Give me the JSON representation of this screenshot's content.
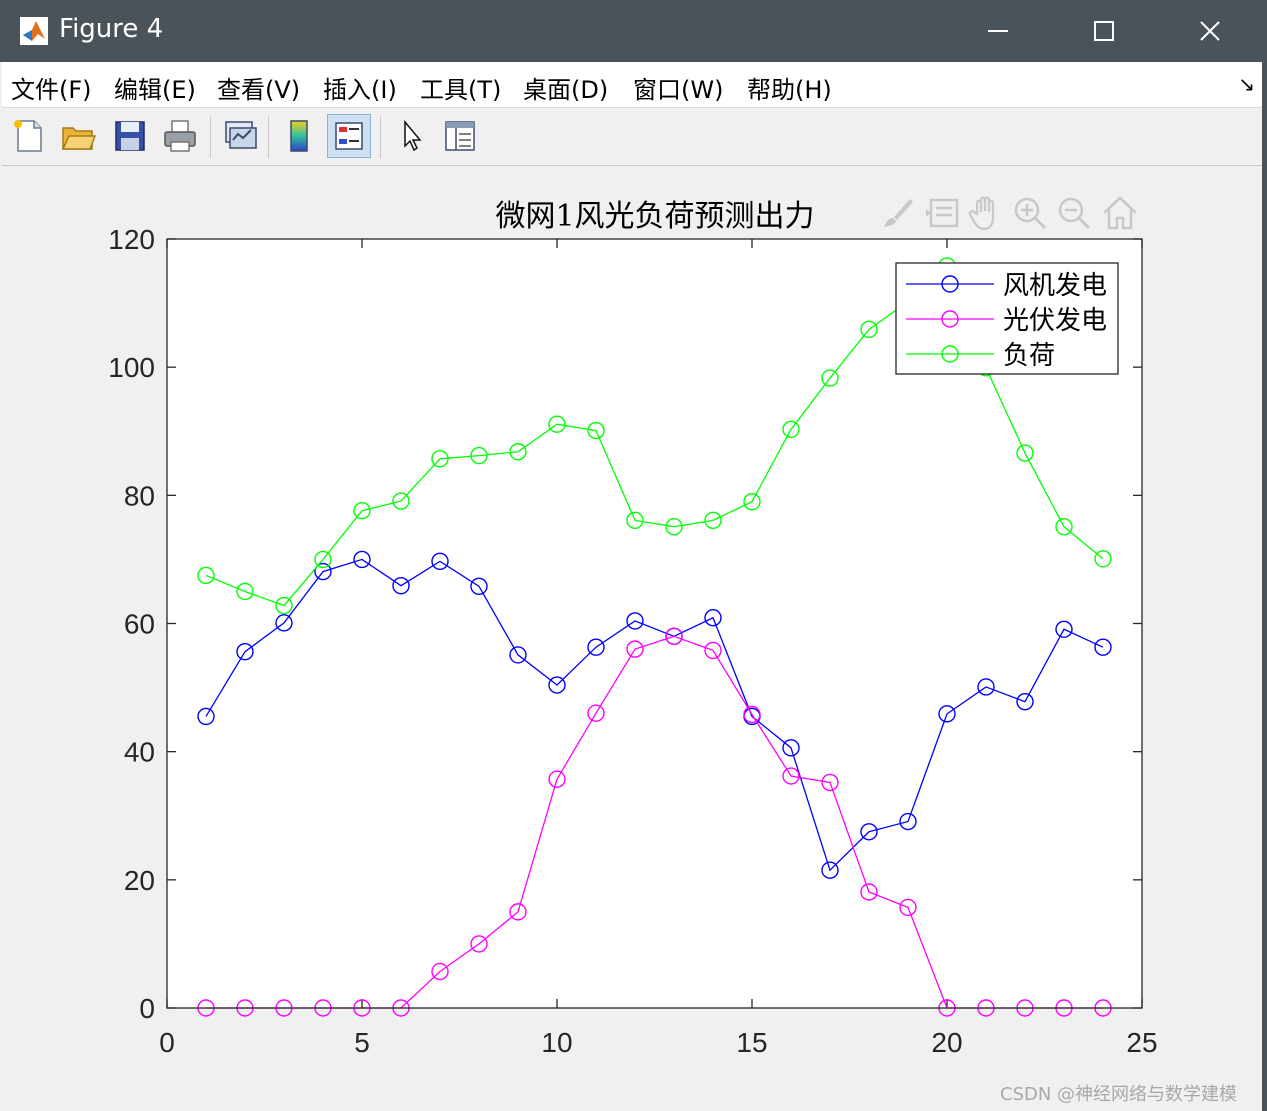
{
  "window": {
    "title": "Figure 4",
    "minimize_icon": "minimize-icon",
    "maximize_icon": "maximize-icon",
    "close_icon": "close-icon",
    "app_icon": "matlab-icon"
  },
  "menubar": {
    "items": [
      "文件(F)",
      "编辑(E)",
      "查看(V)",
      "插入(I)",
      "工具(T)",
      "桌面(D)",
      "窗口(W)",
      "帮助(H)"
    ],
    "expand_icon": "dock-arrow-icon"
  },
  "toolbar": {
    "buttons": [
      "new-figure-icon",
      "open-file-icon",
      "save-icon",
      "print-icon",
      "link-plot-icon",
      "colorbar-icon",
      "legend-icon",
      "pointer-icon",
      "property-inspector-icon"
    ]
  },
  "axes_toolbar": {
    "buttons": [
      "brush-icon",
      "data-tips-icon",
      "pan-hand-icon",
      "zoom-in-icon",
      "zoom-out-icon",
      "home-icon"
    ]
  },
  "watermark": "CSDN @神经网络与数学建模",
  "chart_data": {
    "type": "line",
    "title": "微网1风光负荷预测出力",
    "xlabel": "",
    "ylabel": "",
    "xlim": [
      0,
      25
    ],
    "ylim": [
      0,
      120
    ],
    "xticks": [
      0,
      5,
      10,
      15,
      20,
      25
    ],
    "yticks": [
      0,
      20,
      40,
      60,
      80,
      100,
      120
    ],
    "grid": false,
    "legend_position": "top-right",
    "marker": "circle",
    "x": [
      1,
      2,
      3,
      4,
      5,
      6,
      7,
      8,
      9,
      10,
      11,
      12,
      13,
      14,
      15,
      16,
      17,
      18,
      19,
      20,
      21,
      22,
      23,
      24
    ],
    "series": [
      {
        "name": "风机发电",
        "color": "#0000ff",
        "values": [
          45.5,
          55.6,
          60.1,
          68.1,
          70.0,
          65.9,
          69.7,
          65.8,
          55.1,
          50.4,
          56.3,
          60.4,
          58.0,
          60.9,
          45.5,
          40.6,
          21.5,
          27.5,
          29.1,
          45.9,
          50.1,
          47.8,
          59.1,
          56.3
        ]
      },
      {
        "name": "光伏发电",
        "color": "#ff00ff",
        "values": [
          0,
          0,
          0,
          0,
          0,
          0,
          5.7,
          10.0,
          15.0,
          35.7,
          46.0,
          56.0,
          58.0,
          55.8,
          45.8,
          36.2,
          35.2,
          18.1,
          15.7,
          0,
          0,
          0,
          0,
          0
        ]
      },
      {
        "name": "负荷",
        "color": "#00ff00",
        "values": [
          67.5,
          65.0,
          62.8,
          70.0,
          77.6,
          79.1,
          85.7,
          86.2,
          86.8,
          91.1,
          90.1,
          76.1,
          75.1,
          76.1,
          79.0,
          90.3,
          98.3,
          105.9,
          110.2,
          115.8,
          99.9,
          86.6,
          75.1,
          70.1
        ]
      }
    ]
  }
}
